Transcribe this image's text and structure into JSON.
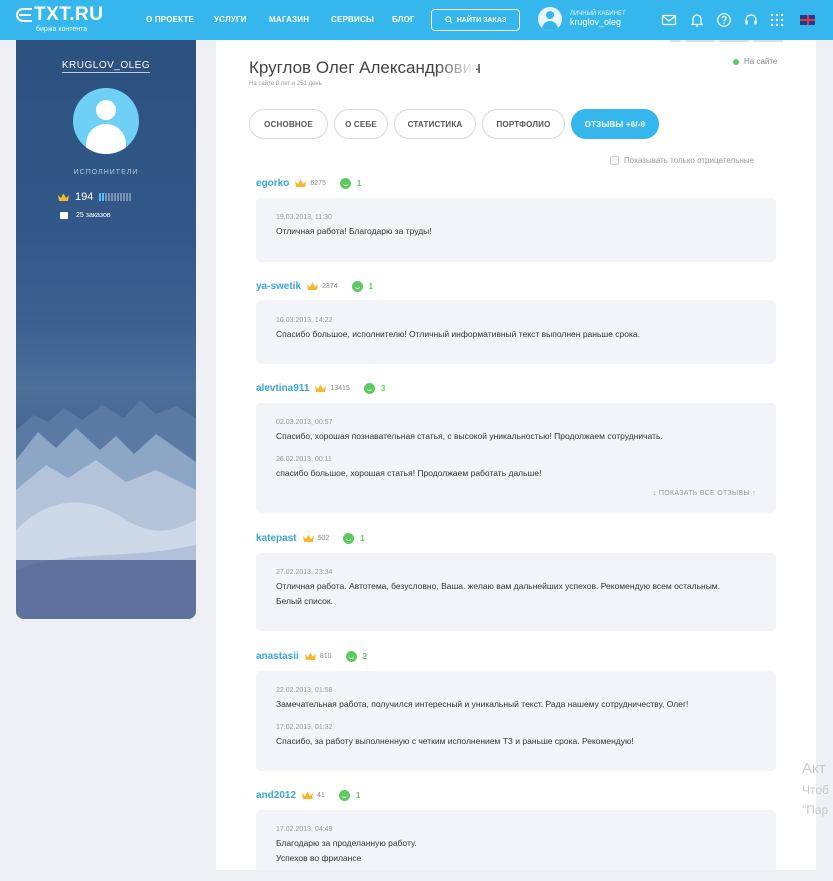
{
  "nav": {
    "logo_text": "TXT.RU",
    "logo_sub": "биржа контента",
    "links": [
      "О ПРОЕКТЕ",
      "УСЛУГИ",
      "МАГАЗИН",
      "СЕРВИСЫ",
      "БЛОГ"
    ],
    "find_order": "НАЙТИ ЗАКАЗ",
    "cabinet_label": "ЛИЧНЫЙ КАБИНЕТ",
    "cabinet_user": "kruglov_oleg",
    "icons": [
      "mail-icon",
      "bell-icon",
      "help-icon",
      "support-icon",
      "apps-icon",
      "uk-flag-icon"
    ]
  },
  "sidebar": {
    "username": "KRUGLOV_OLEG",
    "role": "ИСПОЛНИТЕЛИ",
    "rating": "194",
    "orders": "25 заказов"
  },
  "profile": {
    "full_name": "Круглов Олег Александрович",
    "since": "На сайте 8 лет и 251 день",
    "status": "На сайте"
  },
  "tabs": [
    "ОСНОВНОЕ",
    "О СЕБЕ",
    "СТАТИСТИКА",
    "ПОРТФОЛИО",
    "ОТЗЫВЫ +6/-0"
  ],
  "filter_label": "Показывать только отрицательные",
  "show_all_label": "ПОКАЗАТЬ ВСЕ ОТЗЫВЫ",
  "reviews": [
    {
      "user": "egorko",
      "points": "6275",
      "count": "1",
      "entries": [
        {
          "date": "19.03.2013, 11:30",
          "text": "Отличная работа! Благодарю за труды!"
        }
      ]
    },
    {
      "user": "ya-swetik",
      "points": "2374",
      "count": "1",
      "entries": [
        {
          "date": "10.03.2013, 14:22",
          "text": "Спасибо большое, исполнителю! Отличный информативный текст выполнен раньше срока."
        }
      ]
    },
    {
      "user": "alevtina911",
      "points": "13415",
      "count": "3",
      "entries": [
        {
          "date": "02.03.2013, 00:57",
          "text": "Спасибо, хорошая познавательная статья, с высокой уникальностью! Продолжаем сотрудничать."
        },
        {
          "date": "26.02.2013, 00:11",
          "text": "спасибо большое, хорошая статья! Продолжаем работать дальше!"
        }
      ]
    },
    {
      "user": "katepast",
      "points": "502",
      "count": "1",
      "entries": [
        {
          "date": "27.02.2013, 23:34",
          "text": "Отличная работа. Автотема, безусловно, Ваша. желаю вам дальнейших успехов. Рекомендую всем остальным. Белый список."
        }
      ]
    },
    {
      "user": "anastasii",
      "points": "810",
      "count": "2",
      "entries": [
        {
          "date": "22.02.2013, 01:58",
          "text": "Замечательная работа, получился интересный и уникальный текст. Рада нашему сотрудничеству, Олег!"
        },
        {
          "date": "17.02.2013, 01:32",
          "text": "Спасибо, за работу выполненную с четким исполнением ТЗ и раньше срока. Рекомендую!"
        }
      ]
    },
    {
      "user": "and2012",
      "points": "41",
      "count": "1",
      "entries": [
        {
          "date": "17.02.2013, 04:49",
          "text": "Благодарю за проделанную работу.\nУспехов во фрилансе"
        }
      ]
    }
  ],
  "watermark": [
    "Акт",
    "Чтоб",
    "\"Пар"
  ],
  "colors": {
    "accent": "#35b7ee",
    "link": "#3aa6d9",
    "positive": "#5ccb5f",
    "sidebar": "#2f5583"
  }
}
